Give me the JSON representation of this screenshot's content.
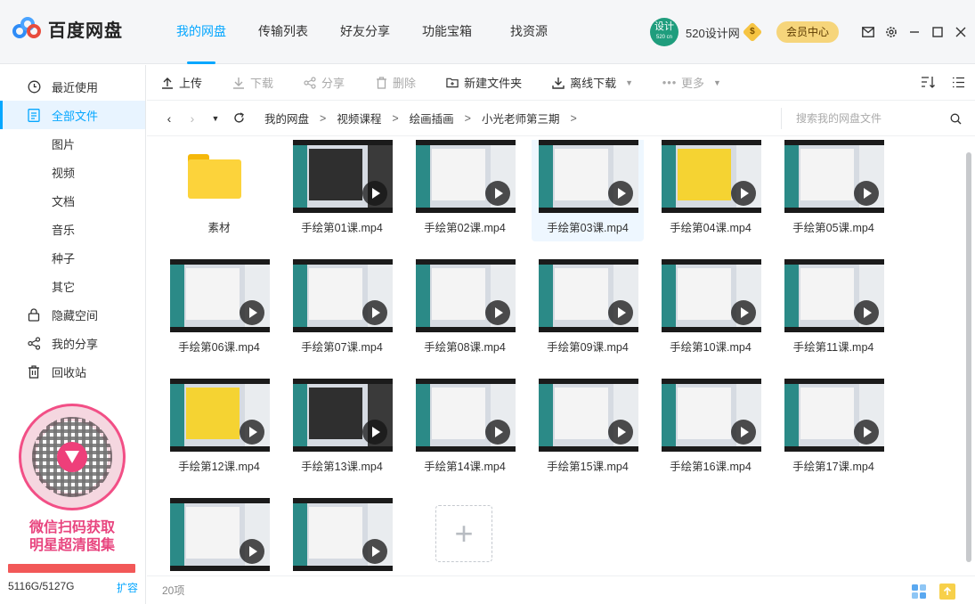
{
  "app": {
    "name": "百度网盘"
  },
  "topnav": {
    "tabs": [
      "我的网盘",
      "传输列表",
      "好友分享",
      "功能宝箱",
      "找资源"
    ]
  },
  "user": {
    "avatar_text": "设计",
    "avatar_sub": "520 cn",
    "name": "520设计网",
    "vip_badge": "$",
    "vip_button": "会员中心"
  },
  "sidebar": {
    "items": [
      {
        "label": "最近使用",
        "icon": "clock-icon"
      },
      {
        "label": "全部文件",
        "icon": "file-icon"
      },
      {
        "label": "图片"
      },
      {
        "label": "视频"
      },
      {
        "label": "文档"
      },
      {
        "label": "音乐"
      },
      {
        "label": "种子"
      },
      {
        "label": "其它"
      },
      {
        "label": "隐藏空间",
        "icon": "lock-icon"
      },
      {
        "label": "我的分享",
        "icon": "share-icon"
      },
      {
        "label": "回收站",
        "icon": "trash-icon"
      }
    ],
    "qr_text_1": "微信扫码获取",
    "qr_text_2": "明星超清图集",
    "storage_used": "5116G/5127G",
    "storage_fill": 0.998,
    "expand": "扩容"
  },
  "toolbar": {
    "upload": "上传",
    "download": "下载",
    "share": "分享",
    "delete": "删除",
    "new_folder": "新建文件夹",
    "offline": "离线下载",
    "more": "更多"
  },
  "path": {
    "crumbs": [
      "我的网盘",
      "视频课程",
      "绘画插画",
      "小光老师第三期"
    ],
    "search_placeholder": "搜索我的网盘文件"
  },
  "files": [
    {
      "name": "素材",
      "kind": "folder"
    },
    {
      "name": "手绘第01课.mp4",
      "kind": "video",
      "style": "dark"
    },
    {
      "name": "手绘第02课.mp4",
      "kind": "video",
      "style": "light"
    },
    {
      "name": "手绘第03课.mp4",
      "kind": "video",
      "style": "light",
      "selected": true
    },
    {
      "name": "手绘第04课.mp4",
      "kind": "video",
      "style": "yellow"
    },
    {
      "name": "手绘第05课.mp4",
      "kind": "video",
      "style": "light"
    },
    {
      "name": "手绘第06课.mp4",
      "kind": "video",
      "style": "light"
    },
    {
      "name": "手绘第07课.mp4",
      "kind": "video",
      "style": "light"
    },
    {
      "name": "手绘第08课.mp4",
      "kind": "video",
      "style": "light"
    },
    {
      "name": "手绘第09课.mp4",
      "kind": "video",
      "style": "light"
    },
    {
      "name": "手绘第10课.mp4",
      "kind": "video",
      "style": "light"
    },
    {
      "name": "手绘第11课.mp4",
      "kind": "video",
      "style": "light"
    },
    {
      "name": "手绘第12课.mp4",
      "kind": "video",
      "style": "yellow"
    },
    {
      "name": "手绘第13课.mp4",
      "kind": "video",
      "style": "dark"
    },
    {
      "name": "手绘第14课.mp4",
      "kind": "video",
      "style": "light"
    },
    {
      "name": "手绘第15课.mp4",
      "kind": "video",
      "style": "light"
    },
    {
      "name": "手绘第16课.mp4",
      "kind": "video",
      "style": "light"
    },
    {
      "name": "手绘第17课.mp4",
      "kind": "video",
      "style": "light"
    },
    {
      "name": "",
      "kind": "video",
      "style": "light"
    },
    {
      "name": "",
      "kind": "video",
      "style": "light"
    }
  ],
  "status": {
    "count": "20项"
  },
  "colors": {
    "accent": "#06a7ff",
    "vip": "#f6d57b",
    "storage": "#f25858",
    "qr_pink": "#e8457f"
  }
}
